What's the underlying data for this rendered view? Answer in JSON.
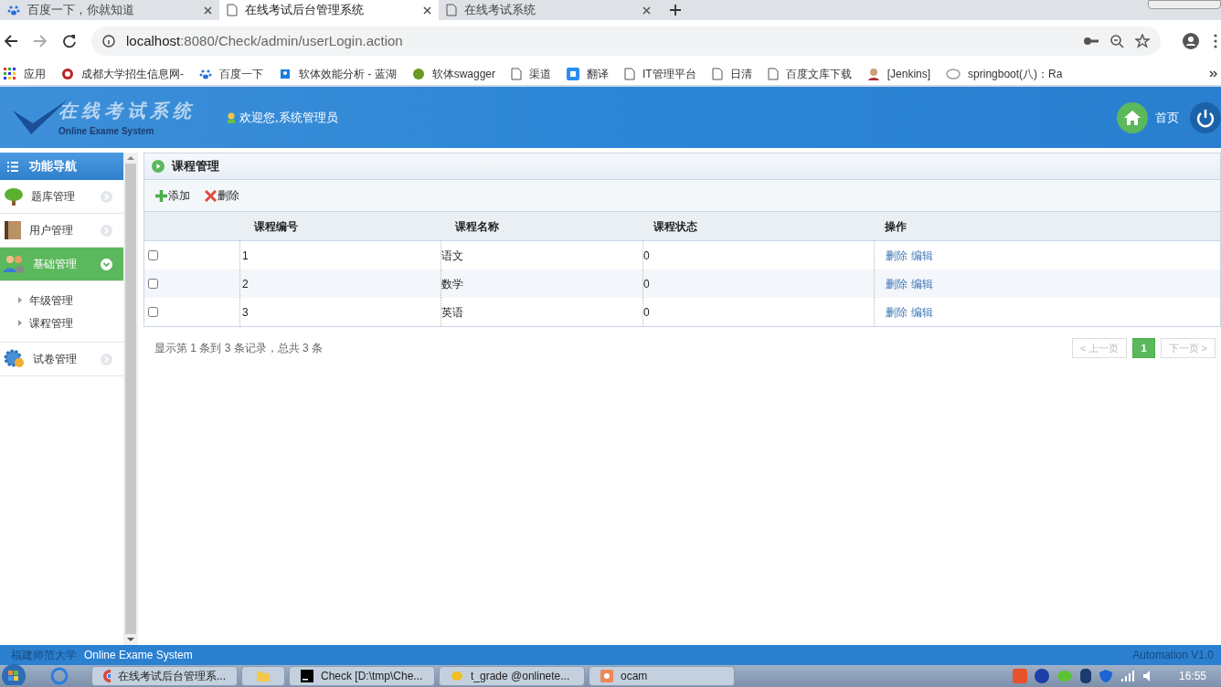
{
  "browser": {
    "tabs": [
      {
        "title": "百度一下，你就知道",
        "selected": false
      },
      {
        "title": "在线考试后台管理系统",
        "selected": true
      },
      {
        "title": "在线考试系统",
        "selected": false
      }
    ],
    "url_host": "localhost",
    "url_rest": ":8080/Check/admin/userLogin.action",
    "bookmarks": [
      {
        "label": "应用"
      },
      {
        "label": "成都大学招生信息网-"
      },
      {
        "label": "百度一下"
      },
      {
        "label": "软体效能分析 - 蓝湖"
      },
      {
        "label": "软体swagger"
      },
      {
        "label": "渠道"
      },
      {
        "label": "翻译"
      },
      {
        "label": "IT管理平台"
      },
      {
        "label": "日清"
      },
      {
        "label": "百度文库下载"
      },
      {
        "label": "[Jenkins]"
      },
      {
        "label": "springboot(八)：Ra"
      }
    ]
  },
  "header": {
    "logo_title": "在线考试系统",
    "logo_subtitle": "Online Exame System",
    "welcome": "欢迎您,系统管理员",
    "home": "首页"
  },
  "sidebar": {
    "title": "功能导航",
    "items": [
      {
        "label": "题库管理",
        "expanded": false
      },
      {
        "label": "用户管理",
        "expanded": false
      },
      {
        "label": "基础管理",
        "expanded": true,
        "children": [
          {
            "label": "年级管理"
          },
          {
            "label": "课程管理"
          }
        ]
      },
      {
        "label": "试卷管理",
        "expanded": false
      }
    ]
  },
  "panel": {
    "title": "课程管理",
    "toolbar": [
      {
        "label": "添加",
        "kind": "add"
      },
      {
        "label": "删除",
        "kind": "delete"
      }
    ],
    "table": {
      "columns": [
        "课程编号",
        "课程名称",
        "课程状态",
        "操作"
      ],
      "rows": [
        {
          "checked": false,
          "cells": [
            "1",
            "语文",
            "0"
          ],
          "actions": [
            "删除",
            "编辑"
          ]
        },
        {
          "checked": false,
          "cells": [
            "2",
            "数学",
            "0"
          ],
          "actions": [
            "删除",
            "编辑"
          ]
        },
        {
          "checked": false,
          "cells": [
            "3",
            "英语",
            "0"
          ],
          "actions": [
            "删除",
            "编辑"
          ]
        }
      ]
    },
    "summary": "显示第 1 条到 3 条记录，总共 3 条",
    "pager": [
      {
        "label": "< 上一页",
        "selected": false
      },
      {
        "label": "1",
        "selected": true
      },
      {
        "label": "下一页 >",
        "selected": false
      }
    ]
  },
  "footer": {
    "left": "福建师范大学",
    "left2": "Online Exame System",
    "right": "Automation V1.0"
  },
  "taskbar": {
    "items": [
      {
        "label": "在线考试后台管理系..."
      },
      {
        "label": "Check [D:\\tmp\\Che..."
      },
      {
        "label": "t_grade @onlinete..."
      },
      {
        "label": "ocam"
      }
    ],
    "time": "16:55"
  }
}
